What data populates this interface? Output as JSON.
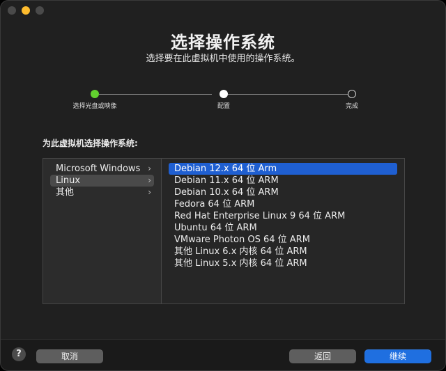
{
  "window": {
    "title": "选择操作系统",
    "subtitle": "选择要在此虚拟机中使用的操作系统。"
  },
  "steps": [
    {
      "label": "选择光盘或映像",
      "state": "done"
    },
    {
      "label": "配置",
      "state": "current"
    },
    {
      "label": "完成",
      "state": "todo"
    }
  ],
  "prompt": "为此虚拟机选择操作系统:",
  "categories": [
    {
      "label": "Microsoft Windows",
      "selected": false
    },
    {
      "label": "Linux",
      "selected": true
    },
    {
      "label": "其他",
      "selected": false
    }
  ],
  "os_list": [
    {
      "label": "Debian 12.x 64 位 Arm",
      "selected": true
    },
    {
      "label": "Debian 11.x 64 位 ARM",
      "selected": false
    },
    {
      "label": "Debian 10.x 64 位 ARM",
      "selected": false
    },
    {
      "label": "Fedora 64 位 ARM",
      "selected": false
    },
    {
      "label": "Red Hat Enterprise Linux 9 64 位 ARM",
      "selected": false
    },
    {
      "label": "Ubuntu 64 位 ARM",
      "selected": false
    },
    {
      "label": "VMware Photon OS 64 位 ARM",
      "selected": false
    },
    {
      "label": "其他 Linux 6.x 内核 64 位 ARM",
      "selected": false
    },
    {
      "label": "其他 Linux 5.x 内核 64 位 ARM",
      "selected": false
    }
  ],
  "buttons": {
    "help": "?",
    "cancel": "取消",
    "back": "返回",
    "continue": "继续"
  },
  "icons": {
    "chevron": "chevron-right-icon",
    "help": "question-icon"
  },
  "colors": {
    "accent": "#1f6fe0",
    "selection": "#1f5fd1",
    "step_done": "#62d02f"
  }
}
